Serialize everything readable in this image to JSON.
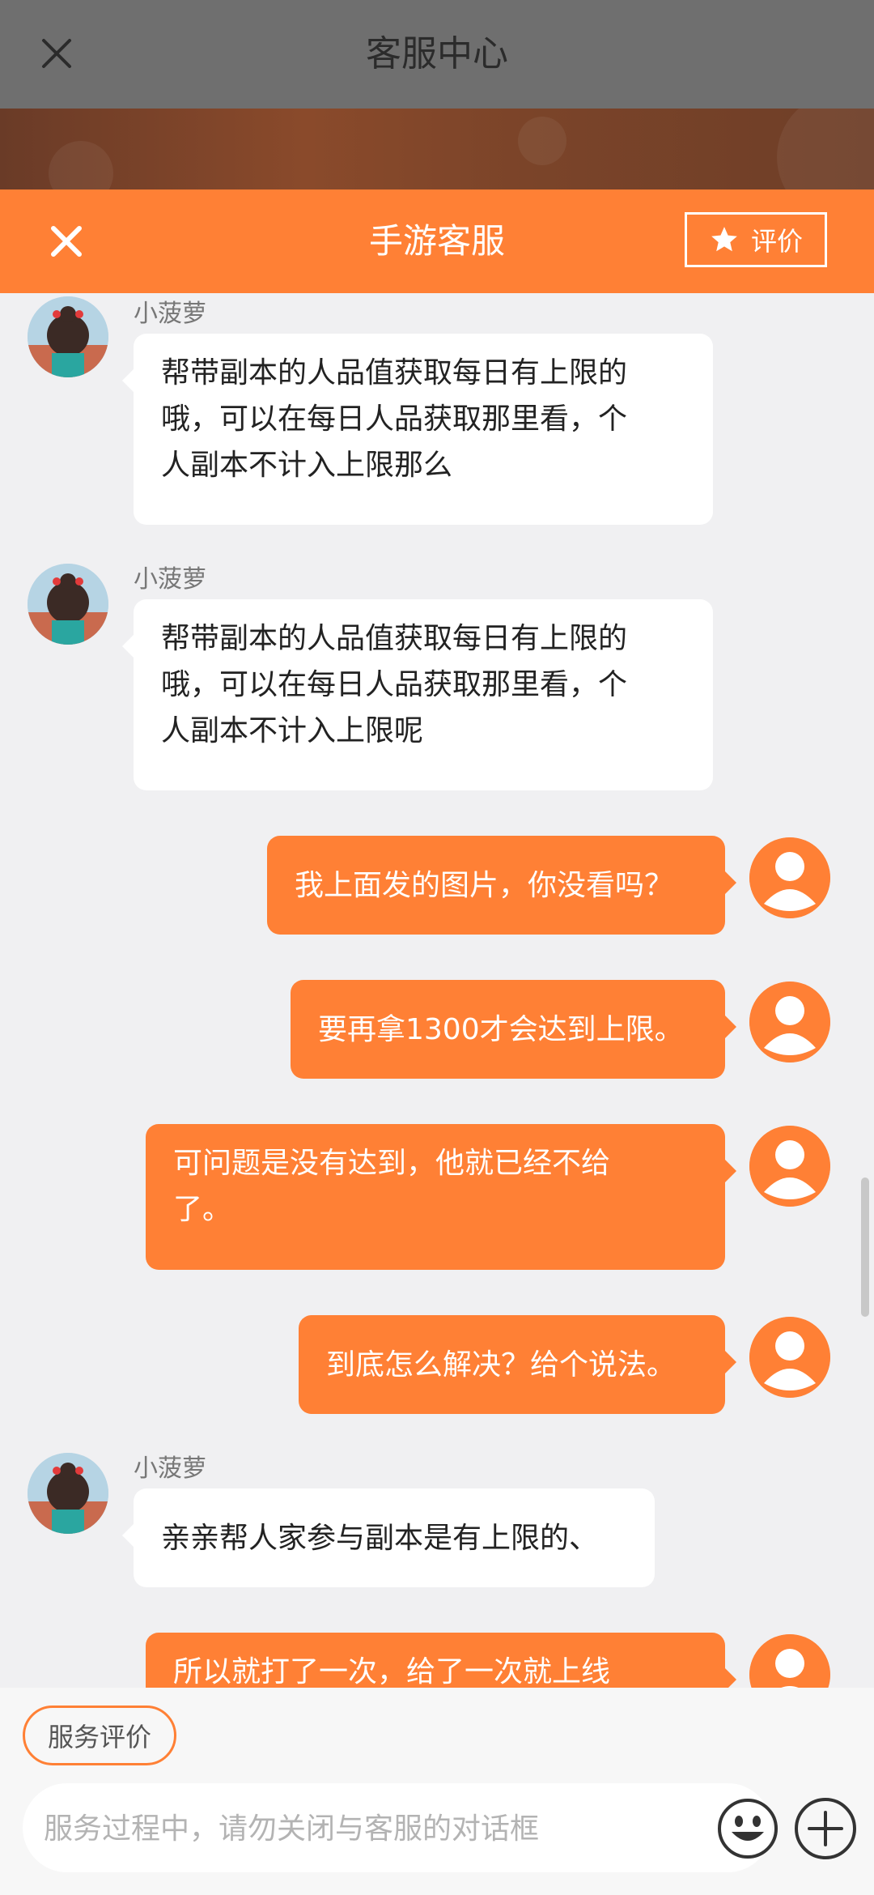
{
  "background_page": {
    "title": "客服中心",
    "close_icon": "close-icon"
  },
  "modal": {
    "title": "手游客服",
    "rate_button_label": "评价",
    "close_icon": "close-icon",
    "accent_color": "#ff8035"
  },
  "messages": [
    {
      "from": "agent",
      "sender": "小菠萝",
      "lines": [
        "帮带副本的人品值获取每日有上限的",
        "哦，可以在每日人品获取那里看，个",
        "人副本不计入上限那么"
      ]
    },
    {
      "from": "agent",
      "sender": "小菠萝",
      "lines": [
        "帮带副本的人品值获取每日有上限的",
        "哦，可以在每日人品获取那里看，个",
        "人副本不计入上限呢"
      ]
    },
    {
      "from": "user",
      "lines": [
        "我上面发的图片，你没看吗？"
      ]
    },
    {
      "from": "user",
      "lines": [
        "要再拿1300才会达到上限。"
      ]
    },
    {
      "from": "user",
      "lines": [
        "可问题是没有达到，他就已经不给",
        "了。"
      ]
    },
    {
      "from": "user",
      "lines": [
        "到底怎么解决？给个说法。"
      ]
    },
    {
      "from": "agent",
      "sender": "小菠萝",
      "lines": [
        "亲亲帮人家参与副本是有上限的、"
      ]
    },
    {
      "from": "user",
      "lines": [
        "所以就打了一次，给了一次就上线"
      ]
    }
  ],
  "bottom": {
    "service_rating_label": "服务评价",
    "input_placeholder": "服务过程中，请勿关闭与客服的对话框",
    "emoji_icon": "emoji-icon",
    "plus_icon": "plus-icon"
  }
}
